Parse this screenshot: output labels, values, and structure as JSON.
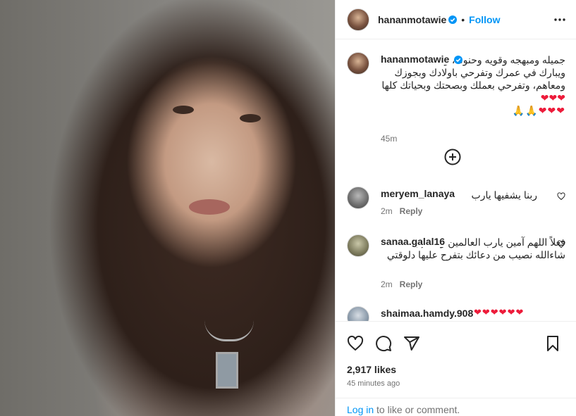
{
  "post": {
    "username": "hananmotawie",
    "separator": "•",
    "follow_label": "Follow"
  },
  "caption": {
    "username": "hananmotawie",
    "text": "جميله ومبهجه وقويه وحنونه، ربنا يسعدك ويبارك في عمرك وتفرحي باولادك وبجوزك ومعاهم، وتفرحي بعملك وبصحتك وبحياتك كلها",
    "hearts_inline": "❤❤❤",
    "hearts_trailing": "❤❤❤",
    "pray": "🙏🙏",
    "time": "45m"
  },
  "comments": [
    {
      "username": "meryem_lanaya",
      "text": "ربنا يشفيها يارب",
      "time": "2m",
      "reply": "Reply"
    },
    {
      "username": "sanaa.galal16",
      "text": "فعلاً اللهم آمين يارب العالمين و لك إن شاءالله نصيب من دعائك بتفرح عليها دلوقتي",
      "time": "2m",
      "reply": "Reply"
    },
    {
      "username": "shaimaa.hamdy.908",
      "text": "❤❤❤❤❤❤"
    }
  ],
  "footer": {
    "likes": "2,917 likes",
    "ago": "45 minutes ago",
    "login_link": "Log in",
    "login_text": " to like or comment."
  },
  "colors": {
    "accent": "#0095f6",
    "heart": "#ed1b3a",
    "muted": "#737373"
  }
}
